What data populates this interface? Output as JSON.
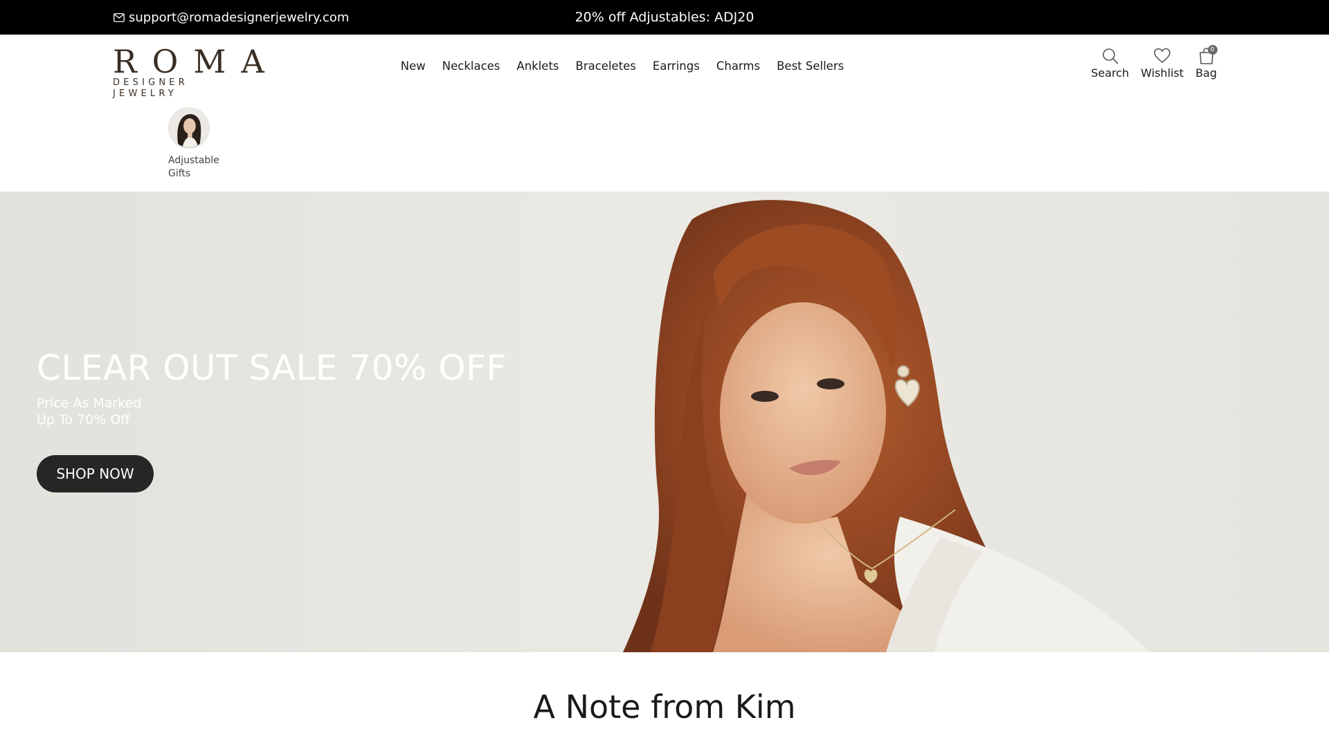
{
  "announcement": {
    "email": "support@romadesignerjewelry.com",
    "promo": "20% off Adjustables: ADJ20"
  },
  "header": {
    "logo_main": "ROMA",
    "logo_sub": "DESIGNER JEWELRY",
    "nav": [
      {
        "label": "New"
      },
      {
        "label": "Necklaces"
      },
      {
        "label": "Anklets"
      },
      {
        "label": "Braceletes"
      },
      {
        "label": "Earrings"
      },
      {
        "label": "Charms"
      },
      {
        "label": "Best Sellers"
      }
    ],
    "tools": {
      "search": "Search",
      "wishlist": "Wishlist",
      "bag": "Bag",
      "bag_count": "0"
    }
  },
  "stories": {
    "label": "Adjustable Gifts"
  },
  "hero": {
    "title": "CLEAR OUT SALE 70% OFF",
    "subtitle_line1": "Price As Marked",
    "subtitle_line2": "Up To 70% Off",
    "button": "SHOP NOW"
  },
  "note": {
    "title": "A Note from Kim"
  },
  "colors": {
    "topbar_bg": "#000000",
    "logo": "#3a2e24",
    "button_bg": "#262626",
    "hero_bg": "#e9e7e2",
    "hair": "#9a4a22"
  }
}
